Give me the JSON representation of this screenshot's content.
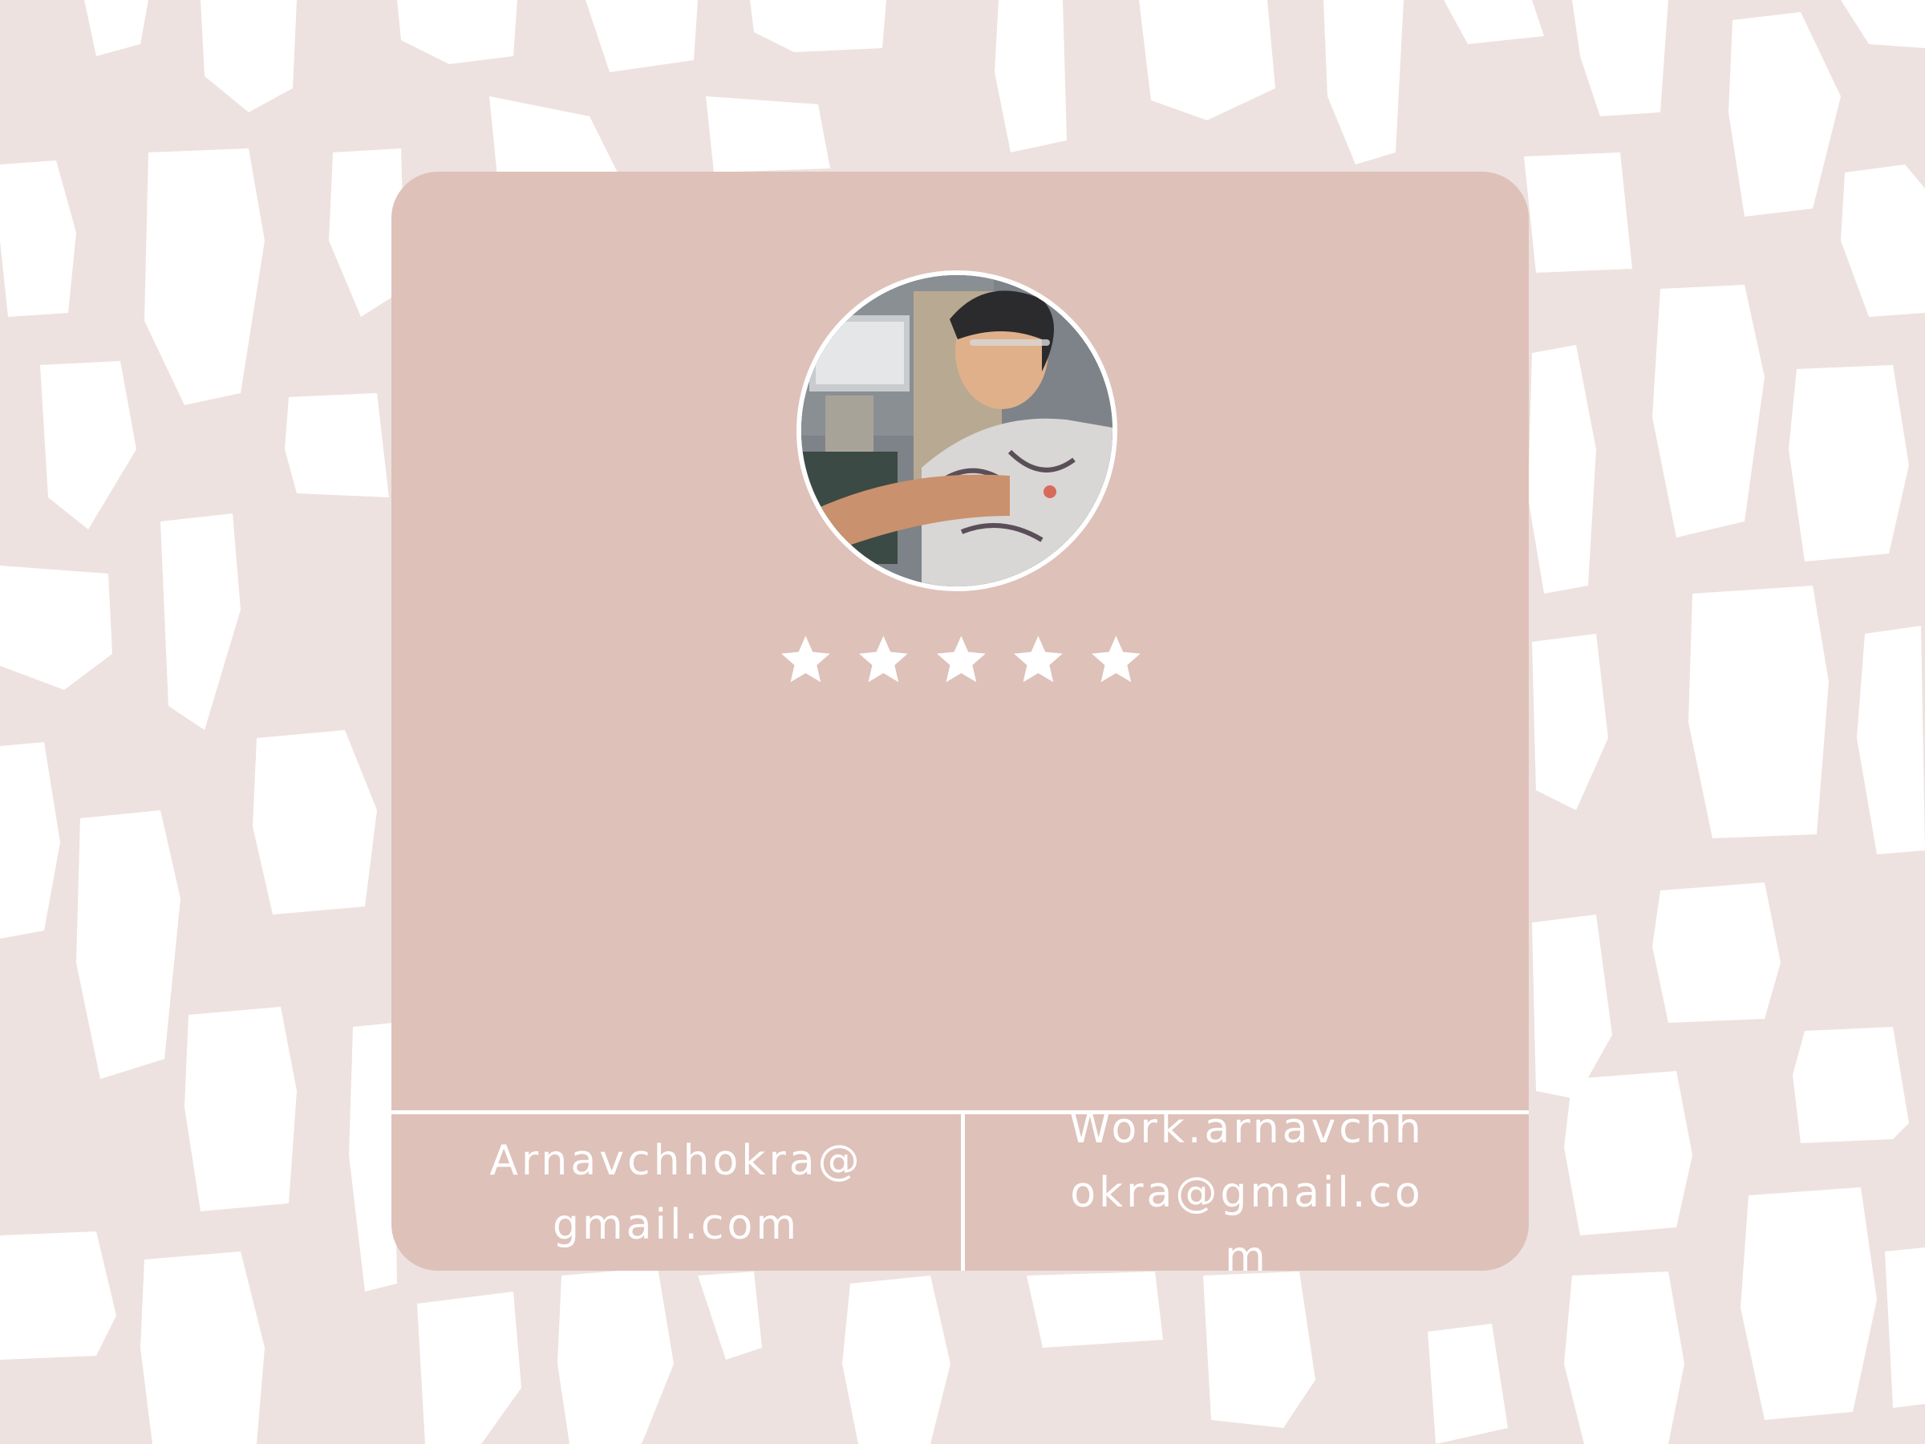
{
  "colors": {
    "background": "#ede2df",
    "blob": "#ffffff",
    "card": "#dec1b9",
    "divider": "#ffffff",
    "star": "#ffffff",
    "text": "#ffffff"
  },
  "profile": {
    "avatar_icon": "profile-photo",
    "rating": {
      "value": 5,
      "max": 5,
      "icon": "star-icon"
    }
  },
  "contacts": {
    "personal_email": "Arnavchhokra@gmail.com",
    "work_email": "Work.arnavchhokra@gmail.com"
  }
}
